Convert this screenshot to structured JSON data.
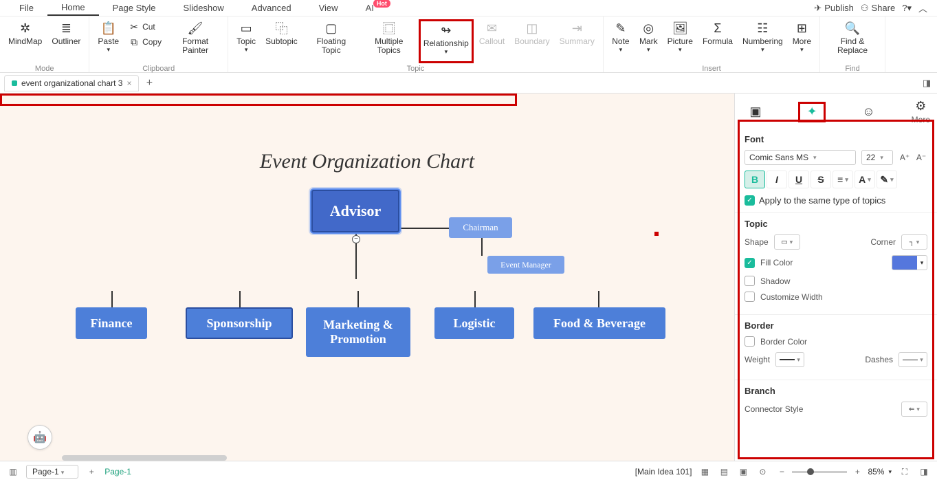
{
  "menu": {
    "items": [
      "File",
      "Home",
      "Page Style",
      "Slideshow",
      "Advanced",
      "View",
      "AI"
    ],
    "activeIndex": 1,
    "ai_badge": "Hot",
    "right": {
      "publish": "Publish",
      "share": "Share"
    }
  },
  "ribbon": {
    "mode": {
      "mindmap": "MindMap",
      "outliner": "Outliner",
      "group": "Mode"
    },
    "clipboard": {
      "paste": "Paste",
      "cut": "Cut",
      "copy": "Copy",
      "format_painter": "Format Painter",
      "group": "Clipboard"
    },
    "topic": {
      "topic": "Topic",
      "subtopic": "Subtopic",
      "floating": "Floating Topic",
      "multiple": "Multiple Topics",
      "relationship": "Relationship",
      "callout": "Callout",
      "boundary": "Boundary",
      "summary": "Summary",
      "group": "Topic"
    },
    "insert": {
      "note": "Note",
      "mark": "Mark",
      "picture": "Picture",
      "formula": "Formula",
      "numbering": "Numbering",
      "more": "More",
      "group": "Insert"
    },
    "find": {
      "find_replace": "Find & Replace",
      "group": "Find"
    }
  },
  "tab": {
    "name": "event organizational chart 3"
  },
  "canvas": {
    "title": "Event Organization Chart",
    "advisor": "Advisor",
    "chairman": "Chairman",
    "event_manager": "Event Manager",
    "finance": "Finance",
    "sponsorship": "Sponsorship",
    "marketing": "Marketing & Promotion",
    "logistic": "Logistic",
    "food": "Food & Beverage"
  },
  "panel": {
    "more": "More",
    "font": {
      "title": "Font",
      "family": "Comic Sans MS",
      "size": "22",
      "apply_same": "Apply to the same type of topics"
    },
    "topic": {
      "title": "Topic",
      "shape": "Shape",
      "corner": "Corner",
      "fill_color": "Fill Color",
      "shadow": "Shadow",
      "custom_width": "Customize Width"
    },
    "border": {
      "title": "Border",
      "border_color": "Border Color",
      "weight": "Weight",
      "dashes": "Dashes"
    },
    "branch": {
      "title": "Branch",
      "connector": "Connector Style"
    }
  },
  "status": {
    "page_dd": "Page-1",
    "page_name": "Page-1",
    "idea": "[Main Idea 101]",
    "zoom": "85%"
  }
}
